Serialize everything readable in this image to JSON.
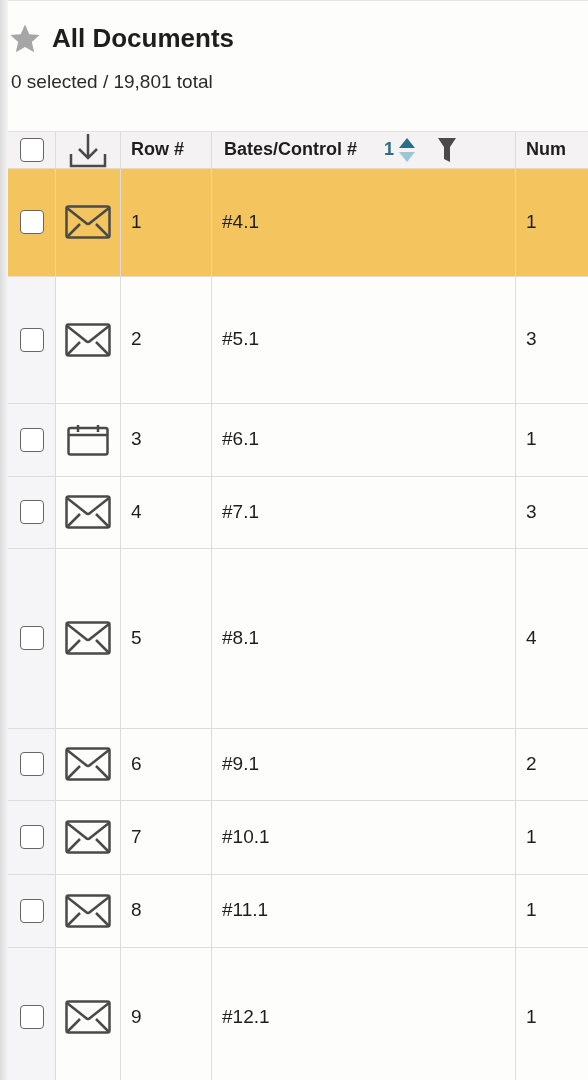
{
  "header": {
    "title": "All Documents",
    "starred": false,
    "summary": "0 selected / 19,801 total"
  },
  "table": {
    "select_all": {
      "checked": false
    },
    "columns": [
      {
        "label": "Row #"
      },
      {
        "label": "Bates/Control #",
        "sort_order": "1",
        "sort_ascending": true,
        "filter": true
      },
      {
        "label": "Num"
      }
    ],
    "rows": [
      {
        "kind": "email",
        "checked": false,
        "highlighted": true,
        "row": "1",
        "bates": "#4.1",
        "num": "1"
      },
      {
        "kind": "email",
        "checked": false,
        "highlighted": false,
        "row": "2",
        "bates": "#5.1",
        "num": "3"
      },
      {
        "kind": "calendar",
        "checked": false,
        "highlighted": false,
        "row": "3",
        "bates": "#6.1",
        "num": "1"
      },
      {
        "kind": "email",
        "checked": false,
        "highlighted": false,
        "row": "4",
        "bates": "#7.1",
        "num": "3"
      },
      {
        "kind": "email",
        "checked": false,
        "highlighted": false,
        "row": "5",
        "bates": "#8.1",
        "num": "4"
      },
      {
        "kind": "email",
        "checked": false,
        "highlighted": false,
        "row": "6",
        "bates": "#9.1",
        "num": "2"
      },
      {
        "kind": "email",
        "checked": false,
        "highlighted": false,
        "row": "7",
        "bates": "#10.1",
        "num": "1"
      },
      {
        "kind": "email",
        "checked": false,
        "highlighted": false,
        "row": "8",
        "bates": "#11.1",
        "num": "1"
      },
      {
        "kind": "email",
        "checked": false,
        "highlighted": false,
        "row": "9",
        "bates": "#12.1",
        "num": "1"
      }
    ]
  }
}
